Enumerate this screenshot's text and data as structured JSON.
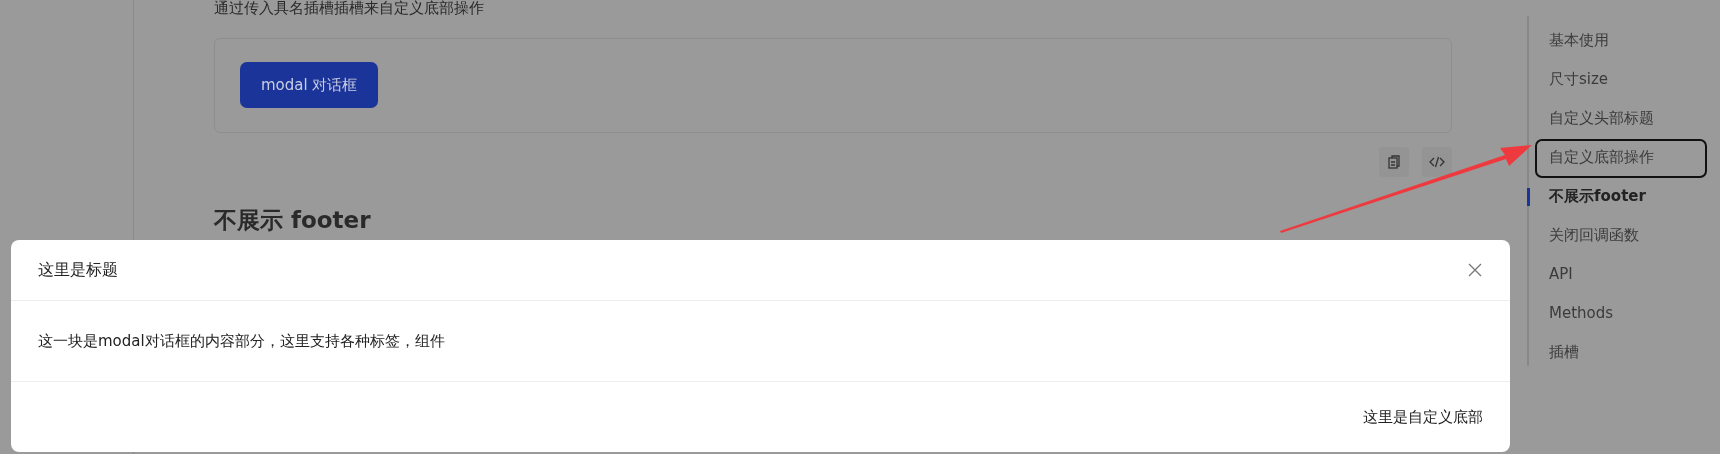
{
  "description": "通过传入具名插槽插槽来自定义底部操作",
  "demo": {
    "button": "modal 对话框"
  },
  "section_heading": "不展示 footer",
  "toc": [
    {
      "label": "基本使用",
      "selected": false,
      "highlighted": false
    },
    {
      "label": "尺寸size",
      "selected": false,
      "highlighted": false
    },
    {
      "label": "自定义头部标题",
      "selected": false,
      "highlighted": false
    },
    {
      "label": "自定义底部操作",
      "selected": false,
      "highlighted": true
    },
    {
      "label": "不展示footer",
      "selected": true,
      "highlighted": false
    },
    {
      "label": "关闭回调函数",
      "selected": false,
      "highlighted": false
    },
    {
      "label": "API",
      "selected": false,
      "highlighted": false
    },
    {
      "label": "Methods",
      "selected": false,
      "highlighted": false
    },
    {
      "label": "插槽",
      "selected": false,
      "highlighted": false
    }
  ],
  "modal": {
    "title": "这里是标题",
    "body": "这一块是modal对话框的内容部分，这里支持各种标签，组件",
    "footer": "这里是自定义底部"
  }
}
